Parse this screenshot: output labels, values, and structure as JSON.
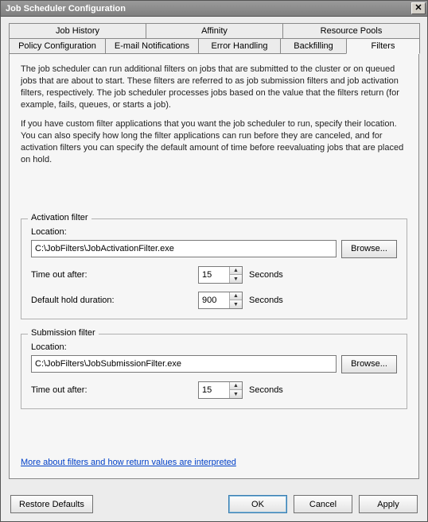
{
  "title": "Job Scheduler Configuration",
  "tabs_row1": [
    "Job History",
    "Affinity",
    "Resource Pools"
  ],
  "tabs_row2": [
    "Policy Configuration",
    "E-mail Notifications",
    "Error Handling",
    "Backfilling",
    "Filters"
  ],
  "active_tab": "Filters",
  "desc1": "The job scheduler can run additional filters on jobs that are submitted to the cluster or on queued jobs that are about to start. These filters are referred to as job submission filters and job activation filters, respectively. The job scheduler processes jobs based on the value that the filters return (for example, fails, queues, or starts a job).",
  "desc2": "If you have custom filter applications that you want the job scheduler to run, specify their location. You can also specify how long the filter applications can run before they are canceled, and for activation filters you can specify the default amount of time before reevaluating jobs that are placed on hold.",
  "activation": {
    "group_title": "Activation filter",
    "location_label": "Location:",
    "location_value": "C:\\JobFilters\\JobActivationFilter.exe",
    "browse": "Browse...",
    "timeout_label": "Time out after:",
    "timeout_value": "15",
    "timeout_unit": "Seconds",
    "hold_label": "Default hold duration:",
    "hold_value": "900",
    "hold_unit": "Seconds"
  },
  "submission": {
    "group_title": "Submission filter",
    "location_label": "Location:",
    "location_value": "C:\\JobFilters\\JobSubmissionFilter.exe",
    "browse": "Browse...",
    "timeout_label": "Time out after:",
    "timeout_value": "15",
    "timeout_unit": "Seconds"
  },
  "link": "More about filters and how return values are interpreted",
  "footer": {
    "restore": "Restore Defaults",
    "ok": "OK",
    "cancel": "Cancel",
    "apply": "Apply"
  }
}
